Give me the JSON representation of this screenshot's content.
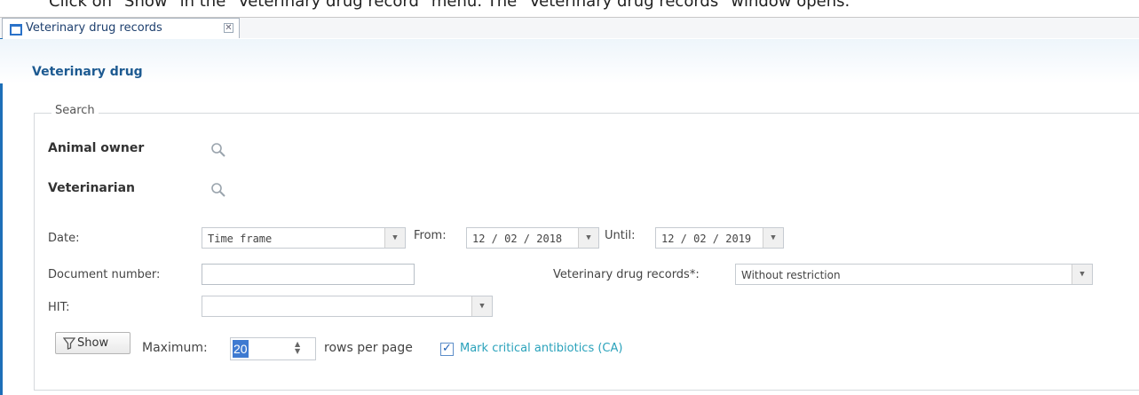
{
  "caption": "Click on \"Show\" in the \"Veterinary drug record\" menu. The \"Veterinary drug records\" window opens.",
  "tab": {
    "label": "Veterinary drug records",
    "close_glyph": "✕"
  },
  "window": {
    "title": "Veterinary drug"
  },
  "search": {
    "legend": "Search",
    "animal_owner_label": "Animal owner",
    "veterinarian_label": "Veterinarian",
    "date_label": "Date:",
    "date_mode": "Time frame",
    "from_label": "From:",
    "from_value": "12 / 02 / 2018",
    "until_label": "Until:",
    "until_value": "12 / 02 / 2019",
    "document_number_label": "Document number:",
    "document_number_value": "",
    "records_label": "Veterinary drug records*:",
    "records_value": "Without restriction",
    "hit_label": "HIT:",
    "hit_value": ""
  },
  "footer": {
    "show_label": "Show",
    "maximum_label": "Maximum:",
    "maximum_value": "20",
    "rows_per_page_label": "rows per page",
    "mark_ca_label": "Mark critical antibiotics (CA)",
    "mark_ca_checked": true
  },
  "icons": [
    "window-icon",
    "close-icon",
    "search-icon",
    "filter-icon",
    "chevron-down-icon",
    "spinner-arrows-icon",
    "checkmark-icon"
  ],
  "colors": {
    "accent": "#1d6fb8",
    "title": "#1d5a91",
    "checkbox_label": "#2aa2bb",
    "selection": "#3e7ad1"
  }
}
